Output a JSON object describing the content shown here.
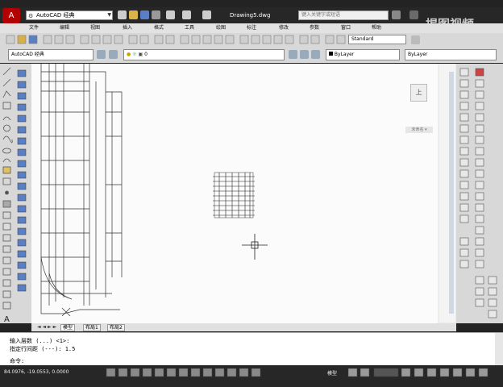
{
  "app": {
    "menu_glyph": "A",
    "document_title": "Drawing5.dwg"
  },
  "workspace": {
    "value": "AutoCAD 经典"
  },
  "help_search": {
    "placeholder": "键入关键字或短语"
  },
  "menus": [
    "文件",
    "编辑",
    "视图",
    "插入",
    "格式",
    "工具",
    "绘图",
    "标注",
    "修改",
    "参数",
    "窗口",
    "帮助"
  ],
  "toolbar": {
    "text_style": "Standard"
  },
  "props": {
    "workspace_combo": "AutoCAD 经典",
    "layer_combo": "0",
    "color_combo": "ByLayer",
    "linetype_combo": "ByLayer"
  },
  "tabs": [
    "模型",
    "布局1",
    "布局2"
  ],
  "viewcube_label": "上",
  "coord_label": "未命名 ▾",
  "command": {
    "line1": "输入层数 (...) <1>:",
    "line2": "指定行间距 (---): 1.5",
    "prompt": "命令:"
  },
  "status": {
    "coords": "84.0976, -19.0553, 0.0000",
    "model": "模型"
  },
  "watermark": {
    "text": "揭图视频"
  },
  "colors": {
    "app_red": "#b30000",
    "bg_dark": "#272727",
    "canvas": "#fbfbfb"
  }
}
